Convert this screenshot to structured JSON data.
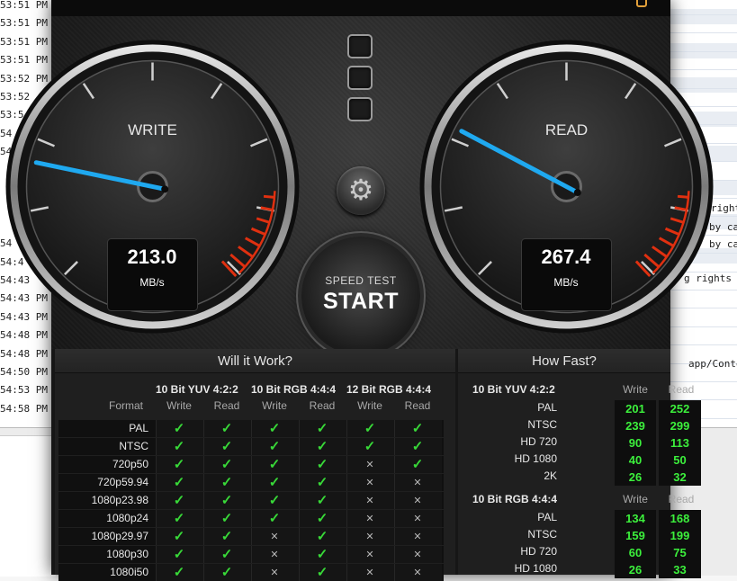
{
  "background_log": {
    "times_left": [
      "53:51 PM",
      "53:51 PM",
      "53:51 PM",
      "53:51 PM",
      "53:52 PM",
      "53:52",
      "53:5",
      "54",
      "54",
      "",
      "",
      "",
      "",
      "54",
      "54:4",
      "54:43",
      "54:43 PM",
      "54:43 PM",
      "54:48 PM",
      "54:48 PM",
      "54:50 PM",
      "54:53 PM",
      "54:58 PM"
    ],
    "right_fragments": [
      "rights k",
      "by ca",
      "by ca",
      "g rights k",
      "app/Contents"
    ]
  },
  "app": {
    "gauges": {
      "write": {
        "label": "WRITE",
        "value": "213.0",
        "unit": "MB/s",
        "level": 0.21
      },
      "read": {
        "label": "READ",
        "value": "267.4",
        "unit": "MB/s",
        "level": 0.27
      }
    },
    "start_button": {
      "line1": "SPEED TEST",
      "line2": "START"
    },
    "gear_icon": "gear-icon",
    "will_it_work": {
      "title": "Will it Work?",
      "format_label": "Format",
      "groups": [
        "10 Bit YUV 4:2:2",
        "10 Bit RGB 4:4:4",
        "12 Bit RGB 4:4:4"
      ],
      "sub": [
        "Write",
        "Read",
        "Write",
        "Read",
        "Write",
        "Read"
      ],
      "rows": [
        {
          "name": "PAL",
          "marks": [
            "check",
            "check",
            "check",
            "check",
            "check",
            "check"
          ]
        },
        {
          "name": "NTSC",
          "marks": [
            "check",
            "check",
            "check",
            "check",
            "check",
            "check"
          ]
        },
        {
          "name": "720p50",
          "marks": [
            "check",
            "check",
            "check",
            "check",
            "cross",
            "check"
          ]
        },
        {
          "name": "720p59.94",
          "marks": [
            "check",
            "check",
            "check",
            "check",
            "cross",
            "cross"
          ]
        },
        {
          "name": "1080p23.98",
          "marks": [
            "check",
            "check",
            "check",
            "check",
            "cross",
            "cross"
          ]
        },
        {
          "name": "1080p24",
          "marks": [
            "check",
            "check",
            "check",
            "check",
            "cross",
            "cross"
          ]
        },
        {
          "name": "1080p29.97",
          "marks": [
            "check",
            "check",
            "cross",
            "check",
            "cross",
            "cross"
          ]
        },
        {
          "name": "1080p30",
          "marks": [
            "check",
            "check",
            "cross",
            "check",
            "cross",
            "cross"
          ]
        },
        {
          "name": "1080i50",
          "marks": [
            "check",
            "check",
            "cross",
            "check",
            "cross",
            "cross"
          ]
        }
      ]
    },
    "how_fast": {
      "title": "How Fast?",
      "sections": [
        {
          "name": "10 Bit YUV 4:2:2",
          "write_label": "Write",
          "read_label": "Read",
          "rows": [
            {
              "name": "PAL",
              "write": "201",
              "read": "252"
            },
            {
              "name": "NTSC",
              "write": "239",
              "read": "299"
            },
            {
              "name": "HD 720",
              "write": "90",
              "read": "113"
            },
            {
              "name": "HD 1080",
              "write": "40",
              "read": "50"
            },
            {
              "name": "2K",
              "write": "26",
              "read": "32"
            }
          ]
        },
        {
          "name": "10 Bit RGB 4:4:4",
          "write_label": "Write",
          "read_label": "Read",
          "rows": [
            {
              "name": "PAL",
              "write": "134",
              "read": "168"
            },
            {
              "name": "NTSC",
              "write": "159",
              "read": "199"
            },
            {
              "name": "HD 720",
              "write": "60",
              "read": "75"
            },
            {
              "name": "HD 1080",
              "write": "26",
              "read": "33"
            }
          ]
        }
      ]
    },
    "colors": {
      "needle": "#1fa9f0",
      "ok": "#38d938",
      "value_green": "#3cf03c",
      "redzone": "#e03010"
    }
  }
}
